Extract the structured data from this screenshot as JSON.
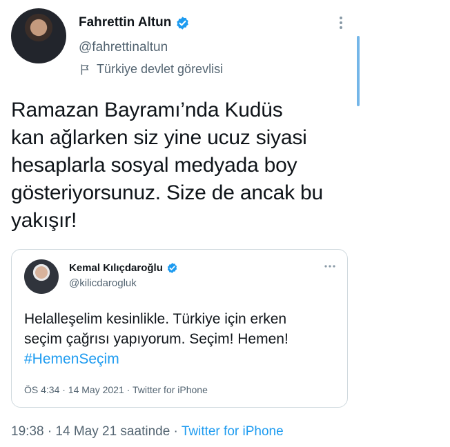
{
  "author": {
    "name": "Fahrettin Altun",
    "handle": "@fahrettinaltun",
    "label": "Türkiye devlet görevlisi",
    "verified": true
  },
  "tweet": {
    "text": "Ramazan Bayramı’nda Kudüs\nkan ağlarken siz yine ucuz siyasi\nhesaplarla sosyal medyada boy\ngösteriyorsunuz. Size de ancak bu\nyakışır!"
  },
  "quoted": {
    "name": "Kemal Kılıçdaroğlu",
    "handle": "@kilicdarogluk",
    "verified": true,
    "text_line1": "Helalleşelim kesinlikle. Türkiye için erken",
    "text_line2": "seçim çağrısı yapıyorum. Seçim! Hemen!",
    "hashtag": "#HemenSeçim",
    "meta": "ÖS 4:34 · 14 May 2021 · Twitter for iPhone"
  },
  "footer": {
    "time": "19:38 · 14 May 21 saatinde · ",
    "source": "Twitter for iPhone"
  },
  "colors": {
    "accent": "#1d9bf0",
    "secondary_text": "#536471",
    "border": "#cfd9de"
  },
  "icons": [
    "verified-badge-icon",
    "flag-icon",
    "more-options-icon"
  ]
}
